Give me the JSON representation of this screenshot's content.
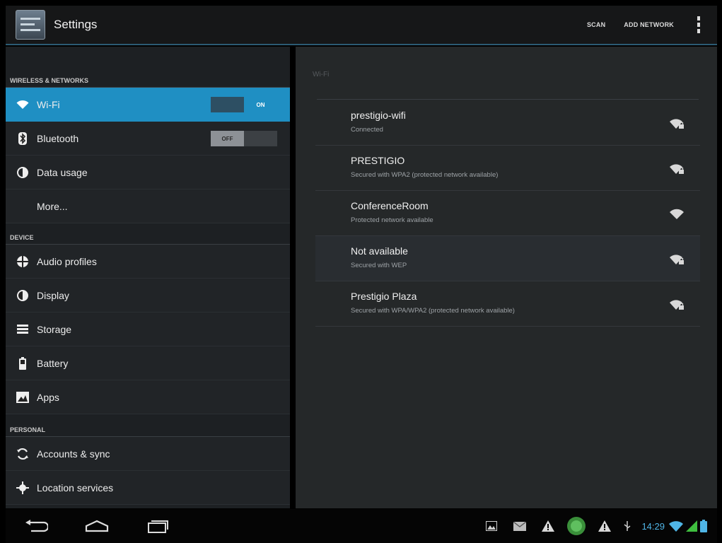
{
  "action_bar": {
    "title": "Settings",
    "scan_label": "SCAN",
    "add_network_label": "ADD NETWORK"
  },
  "sidebar": {
    "sections": [
      {
        "header": "WIRELESS & NETWORKS",
        "items": [
          {
            "label": "Wi-Fi",
            "icon": "wifi-icon",
            "toggle": "ON",
            "selected": true
          },
          {
            "label": "Bluetooth",
            "icon": "bluetooth-icon",
            "toggle": "OFF",
            "selected": false
          },
          {
            "label": "Data usage",
            "icon": "data-usage-icon"
          },
          {
            "label": "More..."
          }
        ]
      },
      {
        "header": "DEVICE",
        "items": [
          {
            "label": "Audio profiles",
            "icon": "audio-profiles-icon"
          },
          {
            "label": "Display",
            "icon": "display-icon"
          },
          {
            "label": "Storage",
            "icon": "storage-icon"
          },
          {
            "label": "Battery",
            "icon": "battery-icon"
          },
          {
            "label": "Apps",
            "icon": "apps-icon"
          }
        ]
      },
      {
        "header": "PERSONAL",
        "items": [
          {
            "label": "Accounts & sync",
            "icon": "sync-icon"
          },
          {
            "label": "Location services",
            "icon": "location-icon"
          }
        ]
      }
    ]
  },
  "wifi_panel": {
    "header": "Wi-Fi",
    "networks": [
      {
        "name": "prestigio-wifi",
        "status": "Connected",
        "secured": true
      },
      {
        "name": "PRESTIGIO",
        "status": "Secured with WPA2 (protected network available)",
        "secured": true
      },
      {
        "name": "ConferenceRoom",
        "status": "Protected network available",
        "secured": false
      },
      {
        "name": "Not available",
        "status": "Secured with WEP",
        "secured": true
      },
      {
        "name": "Prestigio Plaza",
        "status": "Secured with WPA/WPA2 (protected network available)",
        "secured": true
      }
    ]
  },
  "system_bar": {
    "time": "14:29"
  },
  "colors": {
    "accent": "#1f8fc3",
    "clock": "#4fb5e6",
    "signal_green": "#3fbf3f"
  }
}
